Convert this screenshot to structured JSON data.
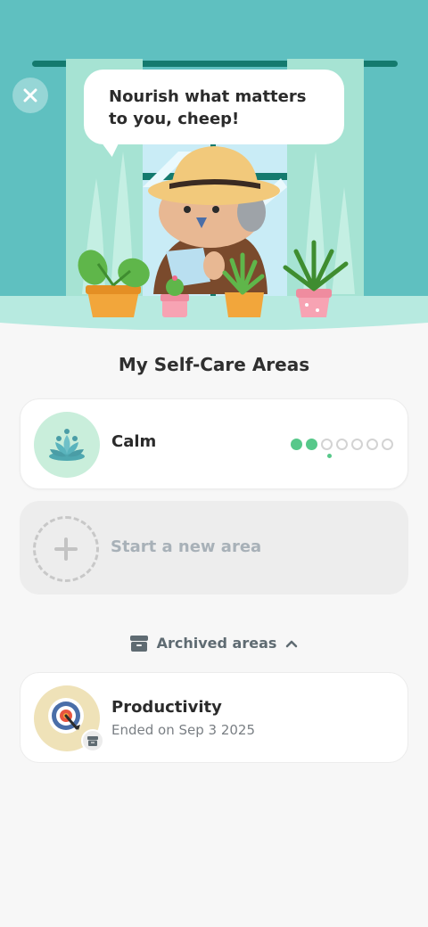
{
  "hero": {
    "speech_text": "Nourish what matters to you, cheep!"
  },
  "main": {
    "section_title": "My Self-Care Areas",
    "active_area": {
      "label": "Calm",
      "icon": "lotus-icon",
      "progress_filled": 2,
      "progress_total": 7
    },
    "new_area": {
      "label": "Start a new area",
      "icon": "plus-icon"
    },
    "archived_toggle": {
      "label": "Archived areas",
      "icon": "archive-box-icon",
      "chevron": "chevron-up-icon"
    },
    "archived_areas": [
      {
        "title": "Productivity",
        "subtitle": "Ended on Sep 3 2025",
        "icon": "target-icon"
      }
    ]
  },
  "colors": {
    "teal": "#5fc0c0",
    "accent_green": "#57c88a",
    "card_bg": "#ffffff",
    "page_bg": "#f7f7f7"
  }
}
